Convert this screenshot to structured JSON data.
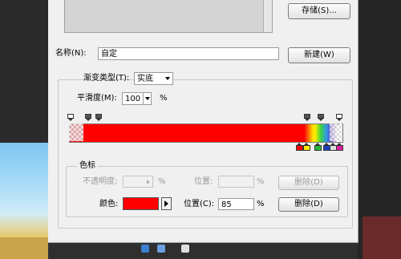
{
  "dialog": {
    "save_button": "存储(S)...",
    "name_label": "名称(N):",
    "name_value": "自定",
    "new_button": "新建(W)",
    "gradient_type_label": "渐变类型(T):",
    "gradient_type_value": "实底",
    "smoothness_label": "平滑度(M):",
    "smoothness_value": "100",
    "smoothness_unit": "%",
    "stops_group_label": "色标",
    "opacity_label": "不透明度:",
    "opacity_unit": "%",
    "opacity_location_label": "位置:",
    "opacity_location_unit": "%",
    "opacity_delete_button": "删除(D)",
    "color_label": "颜色:",
    "color_value": "#ff0000",
    "color_location_label": "位置(C):",
    "color_location_value": "85",
    "color_location_unit": "%",
    "color_delete_button": "删除(D)"
  },
  "gradient": {
    "colors": [
      "#ff0000",
      "#ffd600",
      "#3fd43f",
      "#2e9de0",
      "#5a56d8",
      "#ffffff"
    ],
    "opacity_stops": [
      {
        "fill": "#ffffff",
        "selected": false
      },
      {
        "fill": "#555555",
        "selected": false
      },
      {
        "fill": "#555555",
        "selected": false
      },
      {
        "fill": "#555555",
        "selected": false
      },
      {
        "fill": "#555555",
        "selected": false
      },
      {
        "fill": "#ffffff",
        "selected": false
      }
    ],
    "color_stops": [
      {
        "fill": "#ff0000",
        "selected": true
      },
      {
        "fill": "#ffe800",
        "selected": false
      },
      {
        "fill": "#27b53c",
        "selected": false
      },
      {
        "fill": "#1a3fbf",
        "selected": false
      },
      {
        "fill": "#e0e0e0",
        "selected": false
      },
      {
        "fill": "#e020a0",
        "selected": false
      }
    ]
  }
}
